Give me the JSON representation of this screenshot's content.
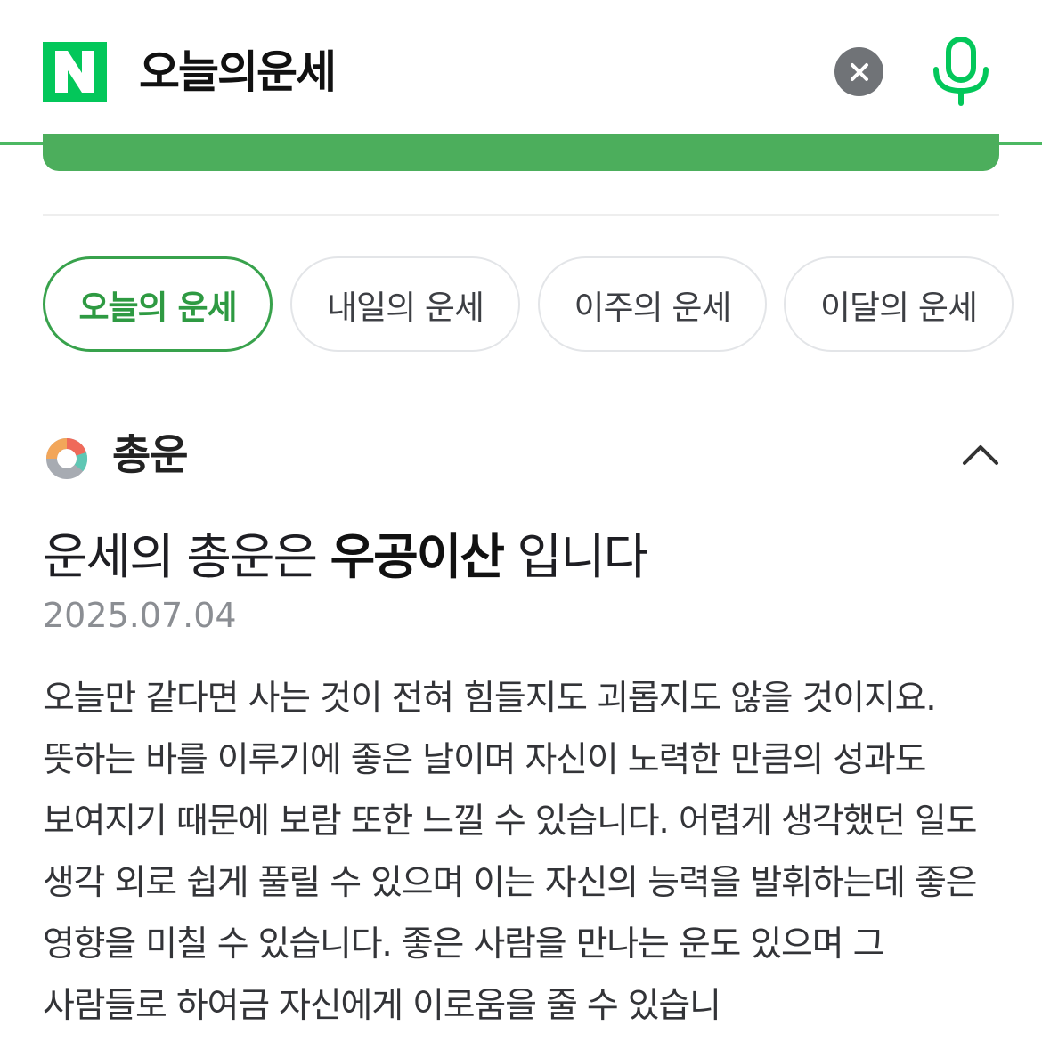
{
  "search": {
    "logo": "N",
    "query": "오늘의운세",
    "clear_icon": "close-icon",
    "mic_icon": "microphone-icon"
  },
  "colors": {
    "brand_green": "#03C75A",
    "accent_green": "#38A24C",
    "bar_green": "#4CAE5C"
  },
  "tabs": [
    {
      "label": "오늘의 운세",
      "active": true
    },
    {
      "label": "내일의 운세",
      "active": false
    },
    {
      "label": "이주의 운세",
      "active": false
    },
    {
      "label": "이달의 운세",
      "active": false
    }
  ],
  "section": {
    "icon": "donut-chart-icon",
    "title": "총운",
    "toggle_icon": "chevron-up-icon"
  },
  "fortune": {
    "headline_prefix": "운세의 총운은",
    "headline_highlight": "우공이산",
    "headline_suffix": "입니다",
    "date": "2025.07.04",
    "body": "오늘만 같다면 사는 것이 전혀 힘들지도 괴롭지도 않을 것이지요. 뜻하는 바를 이루기에 좋은 날이며 자신이 노력한 만큼의 성과도 보여지기 때문에 보람 또한 느낄 수 있습니다. 어렵게 생각했던 일도 생각 외로 쉽게 풀릴 수 있으며 이는 자신의 능력을 발휘하는데 좋은 영향을 미칠 수 있습니다. 좋은 사람을 만나는 운도 있으며 그 사람들로 하여금 자신에게 이로움을 줄 수 있습니"
  }
}
